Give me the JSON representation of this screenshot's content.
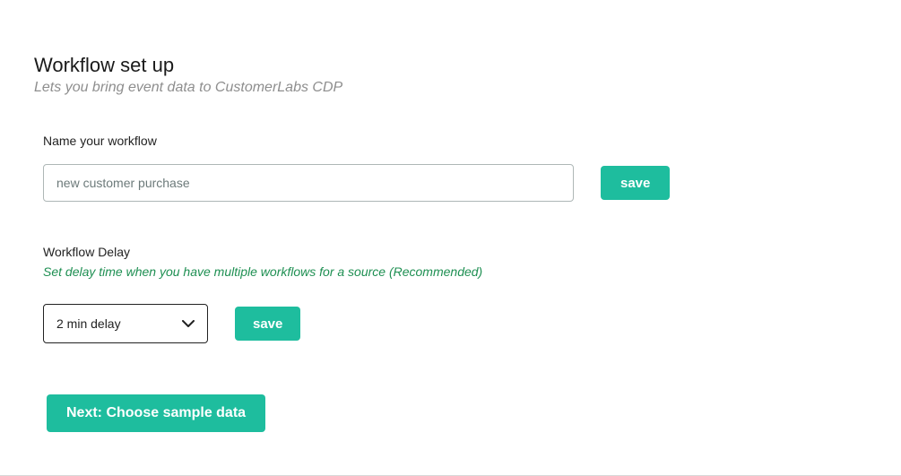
{
  "header": {
    "title": "Workflow set up",
    "subtitle": "Lets you bring event data to CustomerLabs CDP"
  },
  "workflow_name": {
    "label": "Name your workflow",
    "value": "new customer purchase",
    "save_label": "save"
  },
  "workflow_delay": {
    "label": "Workflow Delay",
    "helper": "Set delay time when you have multiple workflows for a source (Recommended)",
    "selected": "2 min delay",
    "save_label": "save"
  },
  "next_button": {
    "label": "Next: Choose sample data"
  }
}
